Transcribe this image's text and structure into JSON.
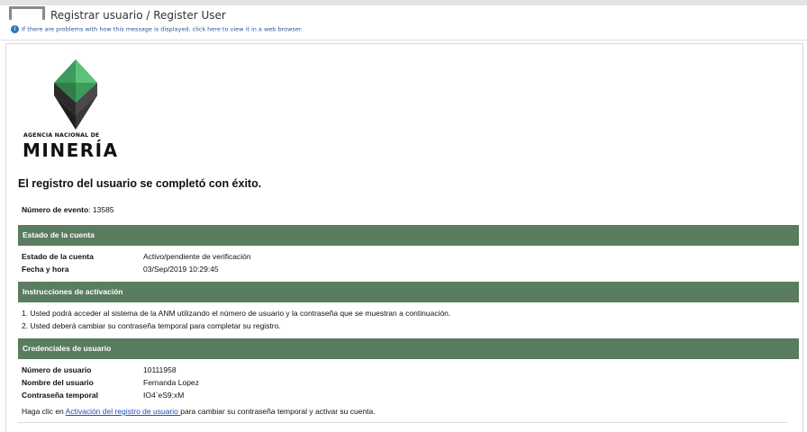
{
  "header": {
    "subject": "Registrar usuario / Register User",
    "info_text": "If there are problems with how this message is displayed, click here to view it in a web browser."
  },
  "logo": {
    "line1": "AGENCIA NACIONAL DE",
    "line2": "MINERÍA",
    "colors": {
      "green": "#3c9b5d",
      "dark": "#333333",
      "light_green": "#5cc27a"
    }
  },
  "message": {
    "success": "El registro del usuario se completó con éxito.",
    "event_label": "Número de evento",
    "event_sep": ": ",
    "event_value": "13585"
  },
  "sections": {
    "account_status": {
      "title": "Estado de la cuenta",
      "rows": [
        {
          "label": "Estado de la cuenta",
          "value": "Activo/pendiente de verificación"
        },
        {
          "label": "Fecha y hora",
          "value": "03/Sep/2019 10:29:45"
        }
      ]
    },
    "activation": {
      "title": "Instrucciones de activación",
      "lines": [
        "1. Usted podrá acceder al sistema de la ANM utilizando el número de usuario y la contraseña que se muestran a continuación.",
        "2. Usted deberá cambiar su contraseña temporal para completar su registro."
      ]
    },
    "credentials": {
      "title": "Credenciales de usuario",
      "rows": [
        {
          "label": "Número de usuario",
          "value": "10111958"
        },
        {
          "label": "Nombre del usuario",
          "value": "Fernanda Lopez"
        },
        {
          "label": "Contraseña temporal",
          "value": "IO4`eS9:xM"
        }
      ],
      "footer_prefix": "Haga clic en ",
      "footer_link": "Activación del registro de usuario ",
      "footer_suffix": "para cambiar su contraseña temporal y activar su cuenta."
    }
  },
  "colors": {
    "section_bar": "#5a7c5f",
    "link": "#1f4db8"
  }
}
